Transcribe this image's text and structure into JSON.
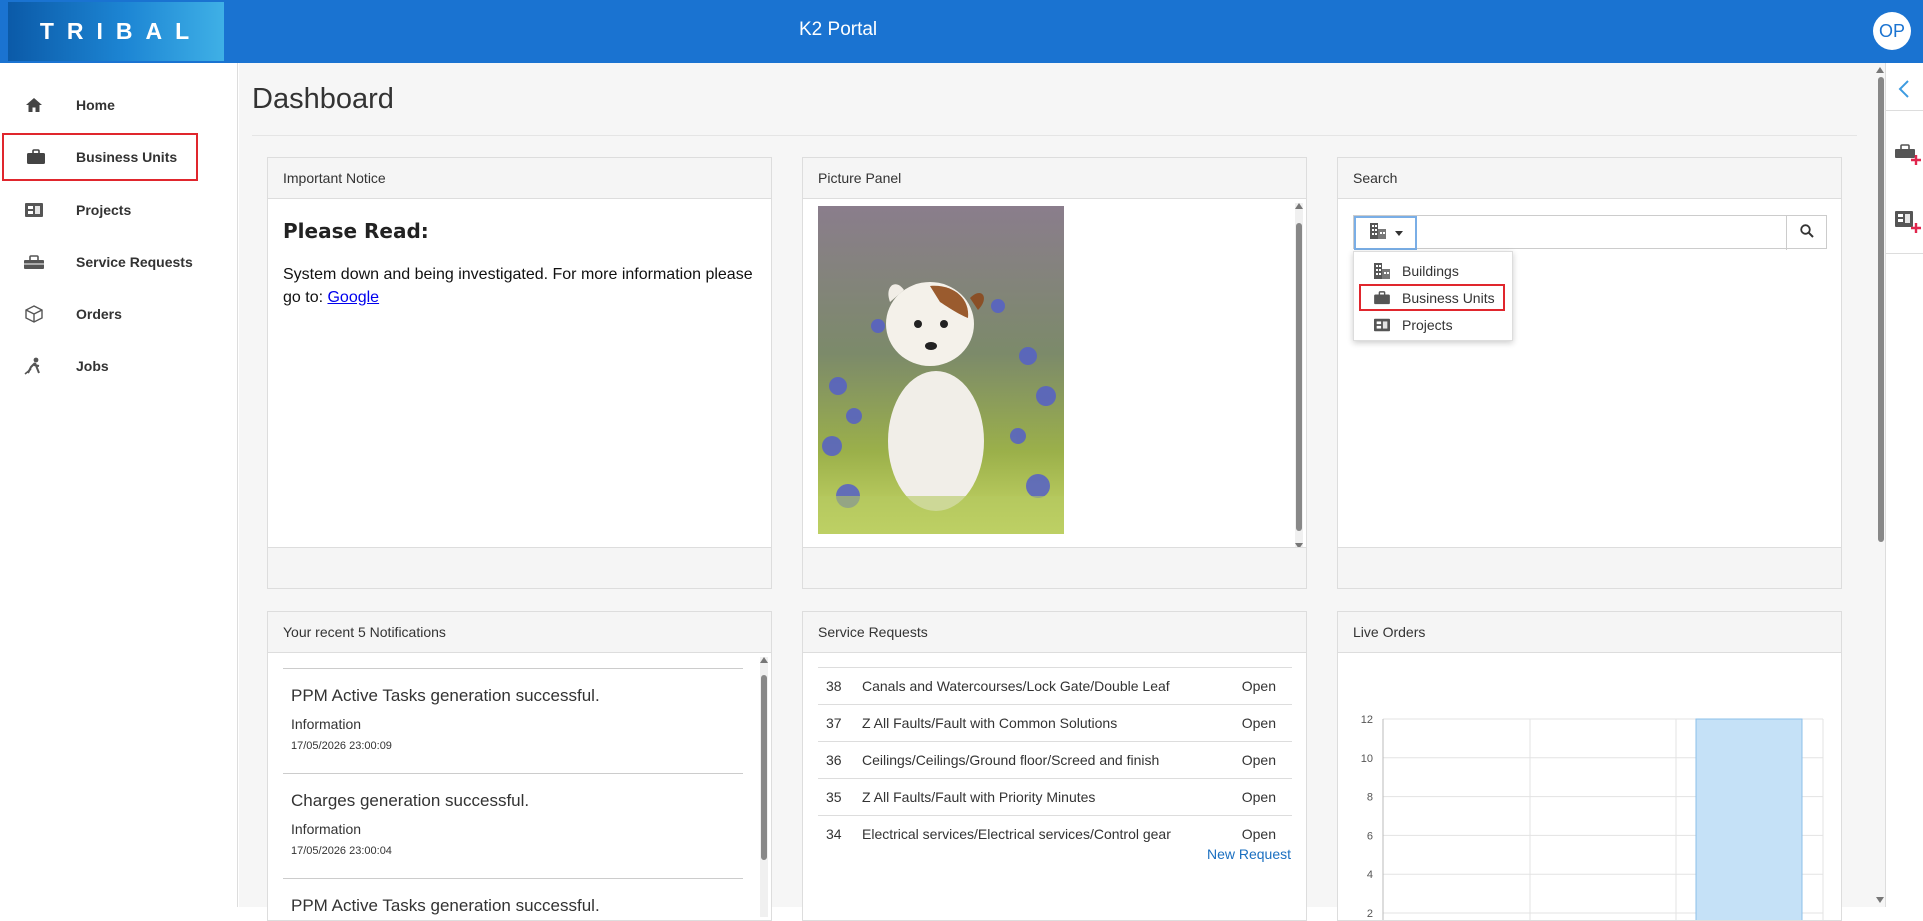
{
  "header": {
    "logo_text": "TRIBAL",
    "app_title": "K2 Portal",
    "avatar_initials": "OP"
  },
  "sidebar": {
    "items": [
      {
        "label": "Home",
        "icon": "home-icon"
      },
      {
        "label": "Business Units",
        "icon": "briefcase-icon"
      },
      {
        "label": "Projects",
        "icon": "projects-icon"
      },
      {
        "label": "Service Requests",
        "icon": "service-requests-icon"
      },
      {
        "label": "Orders",
        "icon": "box-icon"
      },
      {
        "label": "Jobs",
        "icon": "worker-icon"
      }
    ]
  },
  "page": {
    "title": "Dashboard"
  },
  "panels": {
    "notice": {
      "title": "Important Notice",
      "heading": "Please Read:",
      "body": "System down and being investigated. For more information please go to:",
      "link": "Google"
    },
    "picture": {
      "title": "Picture Panel",
      "image_subject": "puppy-in-flowers"
    },
    "search": {
      "title": "Search",
      "input_value": "",
      "options": [
        {
          "label": "Buildings",
          "icon": "building-icon"
        },
        {
          "label": "Business Units",
          "icon": "briefcase-icon"
        },
        {
          "label": "Projects",
          "icon": "projects-icon"
        }
      ]
    },
    "notifications": {
      "title": "Your recent 5 Notifications",
      "items": [
        {
          "title": "PPM Active Tasks generation successful.",
          "category": "Information",
          "date": "17/05/2026 23:00:09"
        },
        {
          "title": "Charges generation successful.",
          "category": "Information",
          "date": "17/05/2026 23:00:04"
        },
        {
          "title": "PPM Active Tasks generation successful."
        }
      ]
    },
    "service_requests": {
      "title": "Service Requests",
      "rows": [
        {
          "id": "38",
          "desc": "Canals and Watercourses/Lock Gate/Double Leaf",
          "status": "Open"
        },
        {
          "id": "37",
          "desc": "Z All Faults/Fault with Common Solutions",
          "status": "Open"
        },
        {
          "id": "36",
          "desc": "Ceilings/Ceilings/Ground floor/Screed and finish",
          "status": "Open"
        },
        {
          "id": "35",
          "desc": "Z All Faults/Fault with Priority Minutes",
          "status": "Open"
        },
        {
          "id": "34",
          "desc": "Electrical services/Electrical services/Control gear",
          "status": "Open"
        }
      ],
      "new_request": "New Request"
    },
    "live_orders": {
      "title": "Live Orders"
    }
  },
  "chart_data": {
    "type": "bar",
    "title": "Live Orders",
    "y_ticks": [
      "12",
      "10",
      "8",
      "6",
      "4",
      "2"
    ],
    "ylim": [
      0,
      12
    ],
    "bar_values": [
      12
    ],
    "bar_color": "#c5e1f7",
    "grid": true
  },
  "colors": {
    "brand_blue": "#1a73d1",
    "highlight_red": "#e0262d",
    "link": "#1a6fc0"
  }
}
